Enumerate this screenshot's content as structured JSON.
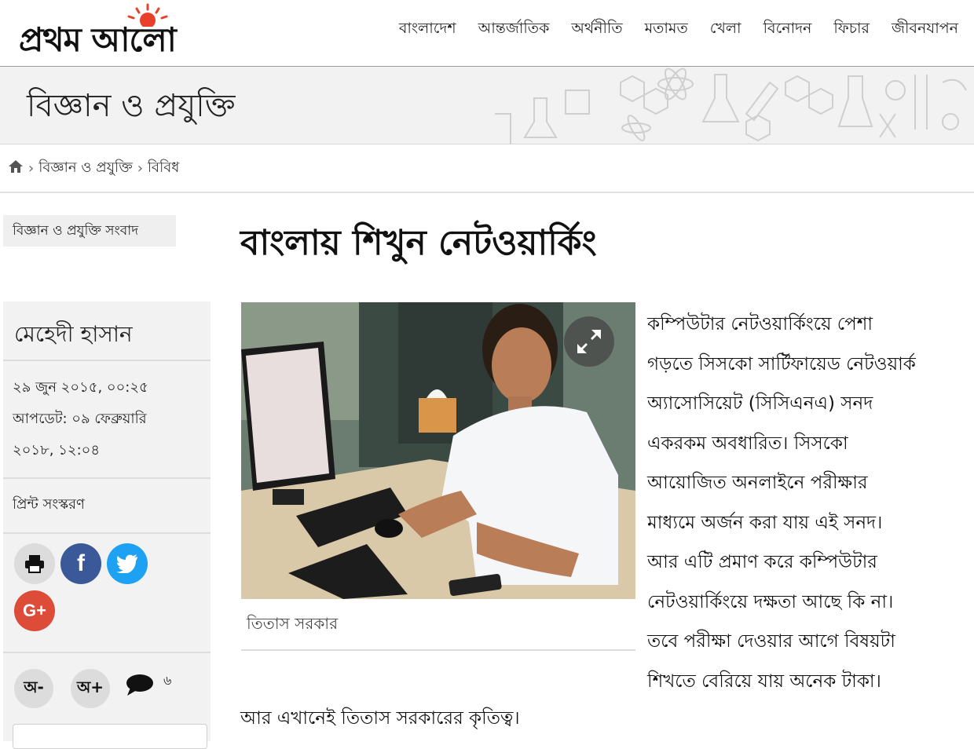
{
  "header": {
    "logo_text": "প্রথম আলো",
    "nav": [
      "বাংলাদেশ",
      "আন্তর্জাতিক",
      "অর্থনীতি",
      "মতামত",
      "খেলা",
      "বিনোদন",
      "ফিচার",
      "জীবনযাপন"
    ]
  },
  "banner": {
    "section_title": "বিজ্ঞান ও প্রযুক্তি"
  },
  "breadcrumb": {
    "icon": "home-icon",
    "items": [
      "বিজ্ঞান ও প্রযুক্তি",
      "বিবিধ"
    ]
  },
  "sidebar": {
    "tag": "বিজ্ঞান ও প্রযুক্তি সংবাদ",
    "author": "মেহেদী হাসান",
    "published": "২৯ জুন ২০১৫, ০০:২৫",
    "updated_line1": "আপডেট: ০৯ ফেব্রুয়ারি",
    "updated_line2": "২০১৮, ১২:০৪",
    "print_edition": "প্রিন্ট সংস্করণ",
    "share_icons": [
      "print-icon",
      "facebook-icon",
      "twitter-icon",
      "google-plus-icon"
    ],
    "font_decrease": "অ-",
    "font_increase": "অ+",
    "comment_count": "৬"
  },
  "article": {
    "headline": "বাংলায় শিখুন নেটওয়ার্কিং",
    "caption": "তিতাস সরকার",
    "paragraph_lines": [
      "কম্পিউটার নেটওয়ার্কিংয়ে পেশা",
      "গড়তে সিসকো সার্টিফায়েড নেটওয়ার্ক",
      "অ্যাসোসিয়েট (সিসিএনএ) সনদ",
      "একরকম অবধারিত। সিসকো",
      "আয়োজিত অনলাইনে পরীক্ষার",
      "মাধ্যমে অর্জন করা যায় এই সনদ।",
      "আর এটি প্রমাণ করে কম্পিউটার",
      "নেটওয়ার্কিংয়ে দক্ষতা আছে কি না।",
      "তবে পরীক্ষা দেওয়ার আগে বিষয়টা",
      "শিখতে বেরিয়ে যায় অনেক টাকা।"
    ],
    "paragraph2": "আর এখানেই তিতাস সরকারের কৃতিত্ব।"
  },
  "colors": {
    "facebook": "#3b5998",
    "twitter": "#1da1f2",
    "google_plus": "#dd4b39",
    "sun": "#e8402a"
  }
}
